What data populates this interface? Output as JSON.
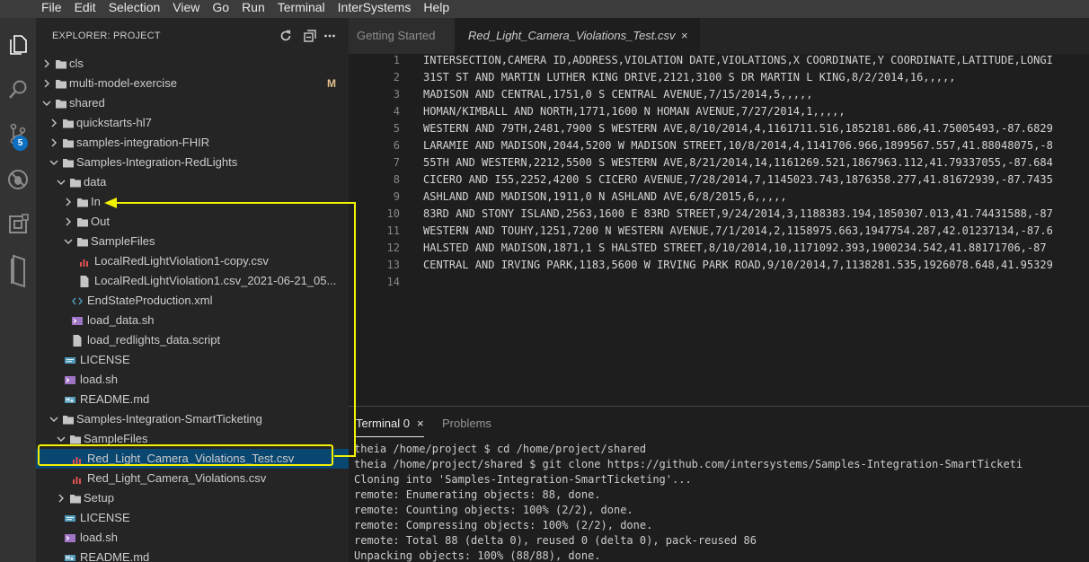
{
  "menu": [
    "File",
    "Edit",
    "Selection",
    "View",
    "Go",
    "Run",
    "Terminal",
    "InterSystems",
    "Help"
  ],
  "activity_bar": {
    "items": [
      {
        "name": "explorer-icon"
      },
      {
        "name": "search-icon"
      },
      {
        "name": "source-control-icon",
        "badge": "5"
      },
      {
        "name": "debug-icon"
      },
      {
        "name": "extensions-icon"
      },
      {
        "name": "objectscript-icon"
      }
    ]
  },
  "sidebar": {
    "title": "EXPLORER: PROJECT",
    "actions": [
      "refresh-icon",
      "collapse-all-icon",
      "more-icon"
    ],
    "tree": [
      {
        "label": "cls",
        "kind": "folder",
        "depth": 0,
        "open": false
      },
      {
        "label": "multi-model-exercise",
        "kind": "folder",
        "depth": 0,
        "open": false,
        "status": "M"
      },
      {
        "label": "shared",
        "kind": "folder",
        "depth": 0,
        "open": true
      },
      {
        "label": "quickstarts-hl7",
        "kind": "folder",
        "depth": 1,
        "open": false
      },
      {
        "label": "samples-integration-FHIR",
        "kind": "folder",
        "depth": 1,
        "open": false
      },
      {
        "label": "Samples-Integration-RedLights",
        "kind": "folder",
        "depth": 1,
        "open": true
      },
      {
        "label": "data",
        "kind": "folder",
        "depth": 2,
        "open": true
      },
      {
        "label": "In",
        "kind": "folder",
        "depth": 3,
        "open": false
      },
      {
        "label": "Out",
        "kind": "folder",
        "depth": 3,
        "open": false
      },
      {
        "label": "SampleFiles",
        "kind": "folder",
        "depth": 3,
        "open": true
      },
      {
        "label": "LocalRedLightViolation1-copy.csv",
        "kind": "csv",
        "depth": 4
      },
      {
        "label": "LocalRedLightViolation1.csv_2021-06-21_05...",
        "kind": "file",
        "depth": 4
      },
      {
        "label": "EndStateProduction.xml",
        "kind": "xml",
        "depth": 3
      },
      {
        "label": "load_data.sh",
        "kind": "sh",
        "depth": 3
      },
      {
        "label": "load_redlights_data.script",
        "kind": "file",
        "depth": 3
      },
      {
        "label": "LICENSE",
        "kind": "license",
        "depth": 2
      },
      {
        "label": "load.sh",
        "kind": "sh",
        "depth": 2
      },
      {
        "label": "README.md",
        "kind": "md",
        "depth": 2
      },
      {
        "label": "Samples-Integration-SmartTicketing",
        "kind": "folder",
        "depth": 1,
        "open": true
      },
      {
        "label": "SampleFiles",
        "kind": "folder",
        "depth": 2,
        "open": true
      },
      {
        "label": "Red_Light_Camera_Violations_Test.csv",
        "kind": "csv",
        "depth": 3,
        "selected": true
      },
      {
        "label": "Red_Light_Camera_Violations.csv",
        "kind": "csv",
        "depth": 3
      },
      {
        "label": "Setup",
        "kind": "folder",
        "depth": 2,
        "open": false
      },
      {
        "label": "LICENSE",
        "kind": "license",
        "depth": 2
      },
      {
        "label": "load.sh",
        "kind": "sh",
        "depth": 2
      },
      {
        "label": "README.md",
        "kind": "md",
        "depth": 2
      }
    ]
  },
  "editor": {
    "tabs": [
      {
        "label": "Getting Started",
        "active": false
      },
      {
        "label": "Red_Light_Camera_Violations_Test.csv",
        "active": true,
        "close": "×"
      }
    ],
    "lines": [
      "INTERSECTION,CAMERA ID,ADDRESS,VIOLATION DATE,VIOLATIONS,X COORDINATE,Y COORDINATE,LATITUDE,LONGI",
      "31ST ST AND MARTIN LUTHER KING DRIVE,2121,3100 S DR MARTIN L KING,8/2/2014,16,,,,,",
      "MADISON AND CENTRAL,1751,0 S CENTRAL AVENUE,7/15/2014,5,,,,,",
      "HOMAN/KIMBALL AND NORTH,1771,1600 N HOMAN AVENUE,7/27/2014,1,,,,,",
      "WESTERN AND 79TH,2481,7900 S WESTERN AVE,8/10/2014,4,1161711.516,1852181.686,41.75005493,-87.6829",
      "LARAMIE AND MADISON,2044,5200 W MADISON STREET,10/8/2014,4,1141706.966,1899567.557,41.88048075,-8",
      "55TH AND WESTERN,2212,5500 S WESTERN AVE,8/21/2014,14,1161269.521,1867963.112,41.79337055,-87.684",
      "CICERO AND I55,2252,4200 S CICERO AVENUE,7/28/2014,7,1145023.743,1876358.277,41.81672939,-87.7435",
      "ASHLAND AND MADISON,1911,0 N ASHLAND AVE,6/8/2015,6,,,,,",
      "83RD AND STONY ISLAND,2563,1600 E 83RD STREET,9/24/2014,3,1188383.194,1850307.013,41.74431588,-87",
      "WESTERN AND TOUHY,1251,7200 N WESTERN AVENUE,7/1/2014,2,1158975.663,1947754.287,42.01237134,-87.6",
      "HALSTED AND MADISON,1871,1 S HALSTED STREET,8/10/2014,10,1171092.393,1900234.542,41.88171706,-87",
      "CENTRAL AND IRVING PARK,1183,5600 W IRVING PARK ROAD,9/10/2014,7,1138281.535,1926078.648,41.95329",
      ""
    ]
  },
  "panel": {
    "tabs": [
      {
        "label": "Terminal 0",
        "active": true,
        "close": "×"
      },
      {
        "label": "Problems",
        "active": false
      }
    ],
    "terminal_lines": [
      "theia /home/project $ cd /home/project/shared",
      "theia /home/project/shared $ git clone https://github.com/intersystems/Samples-Integration-SmartTicketi",
      "Cloning into 'Samples-Integration-SmartTicketing'...",
      "remote: Enumerating objects: 88, done.",
      "remote: Counting objects: 100% (2/2), done.",
      "remote: Compressing objects: 100% (2/2), done.",
      "remote: Total 88 (delta 0), reused 0 (delta 0), pack-reused 86",
      "Unpacking objects: 100% (88/88), done."
    ]
  },
  "colors": {
    "annotation": "#f2f200",
    "folder": "#c5c5c5",
    "csv": "#e05252",
    "xml": "#519aba",
    "sh": "#c678dd",
    "md": "#519aba",
    "modified": "#e2c08d"
  }
}
